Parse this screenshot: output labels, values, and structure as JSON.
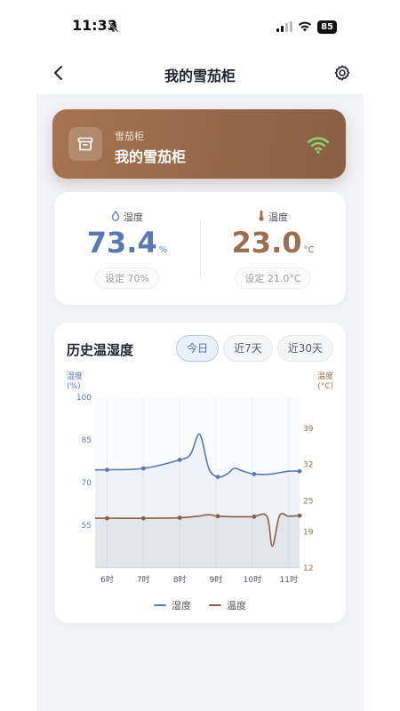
{
  "status_bar": {
    "time": "11:33",
    "battery": "85"
  },
  "navbar": {
    "title": "我的雪茄柜"
  },
  "device": {
    "type_label": "雪茄柜",
    "name": "我的雪茄柜"
  },
  "metrics": {
    "humidity": {
      "label": "湿度",
      "value": "73.4",
      "unit": "%",
      "setpoint": "设定 70%"
    },
    "temperature": {
      "label": "温度",
      "value": "23.0",
      "unit": "°C",
      "setpoint": "设定 21.0°C"
    }
  },
  "history": {
    "title": "历史温湿度",
    "tabs": [
      {
        "label": "今日",
        "active": true
      },
      {
        "label": "近7天",
        "active": false
      },
      {
        "label": "近30天",
        "active": false
      }
    ]
  },
  "colors": {
    "humidity": "#5b79b0",
    "temperature": "#8a5f46",
    "card_brown": "#9a6a4b",
    "wifi": "#8fd26a"
  },
  "icons": [
    "chevron-left-icon",
    "gear-icon",
    "archive-box-icon",
    "wifi-icon",
    "water-drop-icon",
    "thermometer-icon",
    "bell-slash-icon"
  ],
  "chart_data": {
    "type": "line",
    "x": [
      "5:40",
      "6时",
      "7时",
      "8时",
      "8:35",
      "9时",
      "10时",
      "11时",
      "11:30"
    ],
    "xticks": [
      "6时",
      "7时",
      "8时",
      "9时",
      "10时",
      "11时"
    ],
    "y_left": {
      "label_line1": "湿度",
      "label_line2": "(%)",
      "ticks": [
        100,
        85,
        70,
        55
      ],
      "ylim": [
        40,
        100
      ]
    },
    "y_right": {
      "label_line1": "温度",
      "label_line2": "(°C)",
      "ticks": [
        39,
        32,
        25,
        19,
        12
      ],
      "ylim": [
        12,
        45
      ]
    },
    "series": [
      {
        "name": "湿度",
        "axis": "left",
        "color": "#5b79b0",
        "points": [
          [
            5.67,
            74.5
          ],
          [
            6,
            74.5
          ],
          [
            7,
            75
          ],
          [
            8,
            78
          ],
          [
            8.3,
            80
          ],
          [
            8.55,
            87
          ],
          [
            8.8,
            75
          ],
          [
            9.05,
            72
          ],
          [
            9.3,
            73
          ],
          [
            9.5,
            75
          ],
          [
            9.75,
            74
          ],
          [
            10.05,
            73
          ],
          [
            10.5,
            73
          ],
          [
            11,
            74
          ],
          [
            11.3,
            74
          ]
        ],
        "markers": [
          6,
          7,
          8,
          9.05,
          10.05,
          11.3
        ]
      },
      {
        "name": "温度",
        "axis": "right",
        "color": "#8a5f46",
        "points": [
          [
            5.67,
            21.6
          ],
          [
            6,
            21.6
          ],
          [
            7,
            21.6
          ],
          [
            8,
            21.7
          ],
          [
            8.5,
            22.0
          ],
          [
            8.8,
            22.3
          ],
          [
            9.05,
            22.0
          ],
          [
            9.5,
            21.9
          ],
          [
            10,
            21.9
          ],
          [
            10.4,
            22.0
          ],
          [
            10.55,
            16.2
          ],
          [
            10.75,
            22.1
          ],
          [
            11,
            22.0
          ],
          [
            11.3,
            22.1
          ]
        ],
        "markers": [
          6,
          7,
          8,
          9.05,
          10.05,
          11.3
        ]
      }
    ],
    "legend": [
      "湿度",
      "温度"
    ],
    "grid": true
  }
}
